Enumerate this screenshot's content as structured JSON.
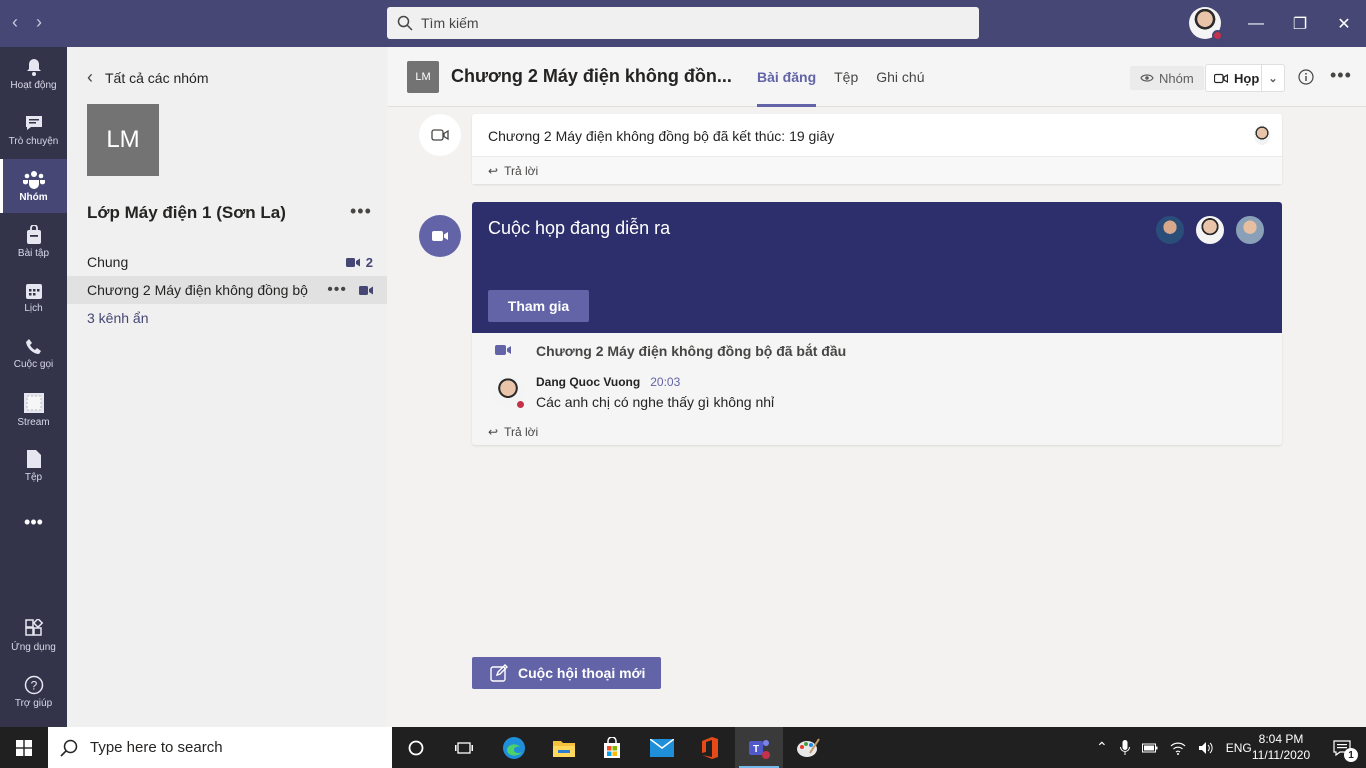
{
  "titlebar": {
    "search_placeholder": "Tìm kiếm"
  },
  "rail": [
    {
      "label": "Hoạt động",
      "icon": "bell-icon"
    },
    {
      "label": "Trò chuyện",
      "icon": "chat-icon"
    },
    {
      "label": "Nhóm",
      "icon": "teams-icon",
      "active": true
    },
    {
      "label": "Bài tập",
      "icon": "assignments-icon"
    },
    {
      "label": "Lịch",
      "icon": "calendar-icon"
    },
    {
      "label": "Cuộc gọi",
      "icon": "phone-icon"
    },
    {
      "label": "Stream",
      "icon": "stream-icon"
    },
    {
      "label": "Tệp",
      "icon": "file-icon"
    },
    {
      "label": "Ứng dụng",
      "icon": "apps-icon"
    },
    {
      "label": "Trợ giúp",
      "icon": "help-icon"
    }
  ],
  "team_panel": {
    "back_label": "Tất cả các nhóm",
    "tile_initials": "LM",
    "team_name": "Lớp Máy điện 1 (Sơn La)",
    "channels": [
      {
        "name": "Chung",
        "meeting_count": "2"
      },
      {
        "name": "Chương 2 Máy điện không đồng bộ",
        "selected": true
      }
    ],
    "hidden_channels": "3 kênh ẩn"
  },
  "header": {
    "tile_initials": "LM",
    "channel_title": "Chương 2 Máy điện không đồn...",
    "tabs": [
      "Bài đăng",
      "Tệp",
      "Ghi chú"
    ],
    "team_button": "Nhóm",
    "meet_button": "Họp"
  },
  "feed": {
    "ended_post": {
      "text": "Chương 2 Máy điện không đồng bộ đã kết thúc: 19 giây",
      "reply": "Trả lời"
    },
    "live_meeting": {
      "title": "Cuộc họp đang diễn ra",
      "join_button": "Tham gia",
      "started_text": "Chương 2 Máy điện không đồng bộ đã bắt đầu",
      "message": {
        "author": "Dang Quoc Vuong",
        "time": "20:03",
        "text": "Các anh chị có nghe thấy gì không nhỉ"
      },
      "reply": "Trả lời"
    },
    "new_conversation": "Cuộc hội thoại mới"
  },
  "taskbar": {
    "search_placeholder": "Type here to search",
    "language": "ENG",
    "time": "8:04 PM",
    "date": "11/11/2020",
    "notification_count": "1"
  },
  "colors": {
    "brand": "#464775",
    "accent": "#6264a7",
    "meeting_banner": "#2c2f6b"
  }
}
